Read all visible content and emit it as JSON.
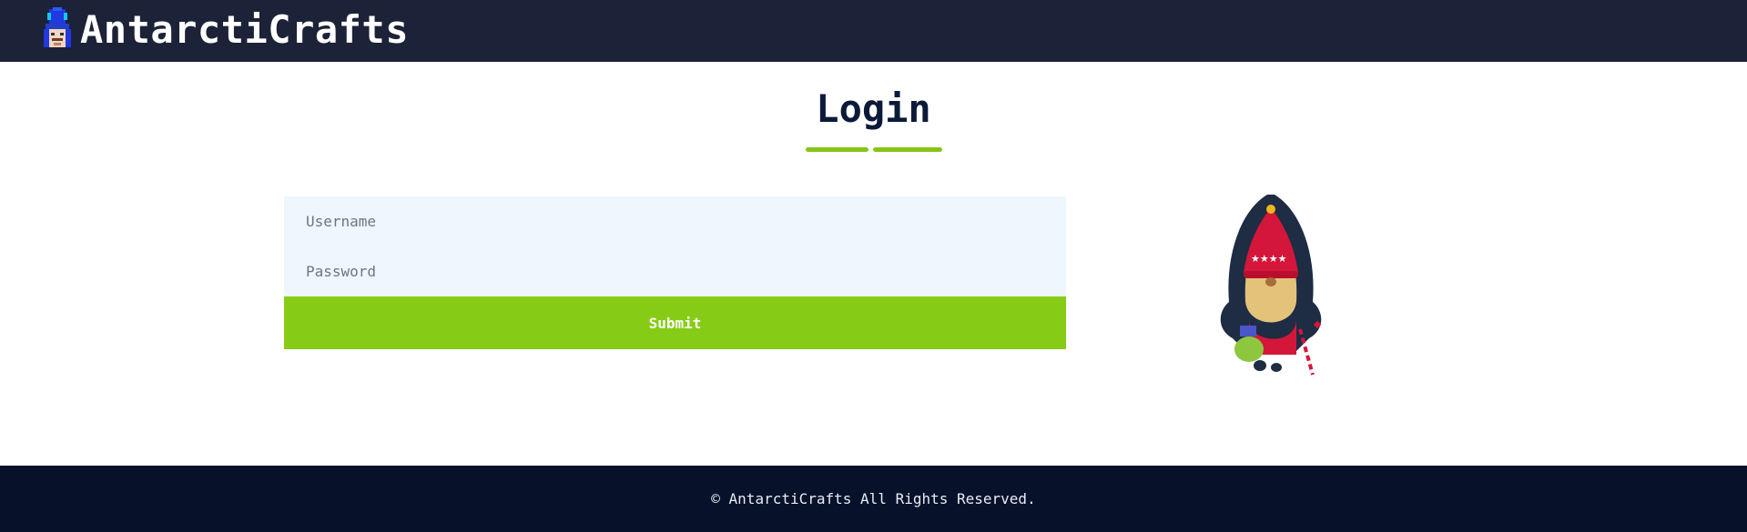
{
  "header": {
    "brand": "AntarctiCrafts",
    "logo_icon": "toy-soldier-icon"
  },
  "main": {
    "title": "Login",
    "form": {
      "username_placeholder": "Username",
      "password_placeholder": "Password",
      "submit_label": "Submit"
    },
    "illustration_icon": "gnome-icon"
  },
  "footer": {
    "copyright": "© AntarctiCrafts All Rights Reserved."
  },
  "colors": {
    "header_bg": "#1c2237",
    "footer_bg": "#07112a",
    "accent": "#86cc16",
    "title": "#0c1a3a",
    "input_bg": "#eef7fd"
  }
}
